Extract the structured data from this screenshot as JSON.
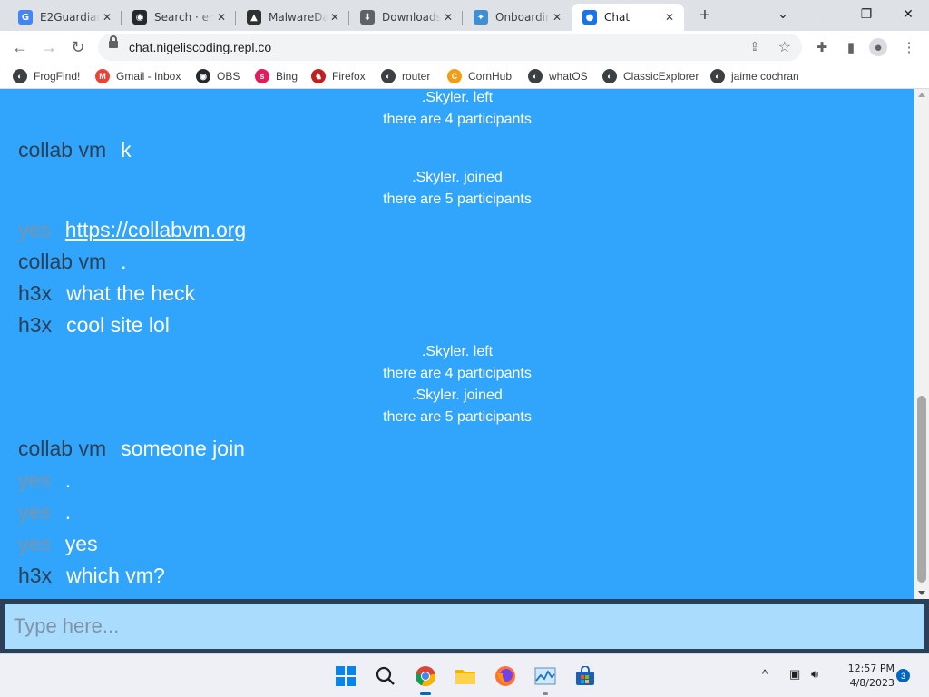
{
  "browser": {
    "tabs": [
      {
        "title": "E2Guardian",
        "icon": "google-icon",
        "color": "#4285f4",
        "glyph": "G"
      },
      {
        "title": "Search · en",
        "icon": "github-icon",
        "color": "#24292e",
        "glyph": "◉"
      },
      {
        "title": "MalwareDa",
        "icon": "malwaredata-icon",
        "color": "#303030",
        "glyph": "▲"
      },
      {
        "title": "Downloads",
        "icon": "download-icon",
        "color": "#5f6368",
        "glyph": "⬇"
      },
      {
        "title": "Onboardin",
        "icon": "replit-onboarding-icon",
        "color": "#3e8ed0",
        "glyph": "✦"
      },
      {
        "title": "Chat",
        "icon": "chat-icon",
        "color": "#1a73e8",
        "glyph": "●"
      }
    ],
    "url": "chat.nigeliscoding.repl.co",
    "bookmarks": [
      {
        "label": "FrogFind!",
        "icon": "globe-icon",
        "color": "#3c4043",
        "glyph": "◐"
      },
      {
        "label": "Gmail - Inbox",
        "icon": "gmail-icon",
        "color": "#ea4335",
        "glyph": "M"
      },
      {
        "label": "OBS",
        "icon": "github-icon",
        "color": "#24292e",
        "glyph": "◉"
      },
      {
        "label": "Bing",
        "icon": "sky-icon",
        "color": "#e21b5a",
        "glyph": "s"
      },
      {
        "label": "Firefox",
        "icon": "firefox-icon",
        "color": "#c41e1e",
        "glyph": "♞"
      },
      {
        "label": "router",
        "icon": "globe-icon",
        "color": "#3c4043",
        "glyph": "◐"
      },
      {
        "label": "CornHub",
        "icon": "cornhub-icon",
        "color": "#f29d12",
        "glyph": "C"
      },
      {
        "label": "whatOS",
        "icon": "globe-icon",
        "color": "#3c4043",
        "glyph": "◐"
      },
      {
        "label": "ClassicExplorer",
        "icon": "globe-icon",
        "color": "#3c4043",
        "glyph": "◐"
      },
      {
        "label": "jaime cochran",
        "icon": "globe-icon",
        "color": "#3c4043",
        "glyph": "◐"
      }
    ]
  },
  "chat": {
    "background": "#31a4fb",
    "system_blocks": [
      {
        "lines": [
          ".Skyler. left",
          "there are 4 participants"
        ]
      },
      {
        "lines": [
          ".Skyler. joined",
          "there are 5 participants"
        ]
      },
      {
        "lines": [
          ".Skyler. left",
          "there are 4 participants",
          ".Skyler. joined",
          "there are 5 participants"
        ]
      }
    ],
    "messages": [
      {
        "user": "collab vm",
        "text": "k",
        "user_style": "dark"
      },
      {
        "user": "yes",
        "text": "https://collabvm.org",
        "user_style": "gray",
        "is_link": true
      },
      {
        "user": "collab vm",
        "text": ".",
        "user_style": "dark"
      },
      {
        "user": "h3x",
        "text": "what the heck",
        "user_style": "dark"
      },
      {
        "user": "h3x",
        "text": "cool site lol",
        "user_style": "dark"
      },
      {
        "user": "collab vm",
        "text": "someone join",
        "user_style": "dark"
      },
      {
        "user": "yes",
        "text": ".",
        "user_style": "gray"
      },
      {
        "user": "yes",
        "text": ".",
        "user_style": "gray"
      },
      {
        "user": "yes",
        "text": "yes",
        "user_style": "gray"
      },
      {
        "user": "h3x",
        "text": "which vm?",
        "user_style": "dark"
      }
    ],
    "input_placeholder": "Type here..."
  },
  "taskbar": {
    "apps": [
      {
        "name": "start-button",
        "icon": "windows-icon",
        "state": ""
      },
      {
        "name": "search-button",
        "icon": "search-icon",
        "state": ""
      },
      {
        "name": "chrome-app",
        "icon": "chrome-icon",
        "state": "active"
      },
      {
        "name": "file-explorer-app",
        "icon": "folder-icon",
        "state": ""
      },
      {
        "name": "firefox-app",
        "icon": "firefox-icon",
        "state": ""
      },
      {
        "name": "task-manager-app",
        "icon": "task-manager-icon",
        "state": "run"
      },
      {
        "name": "store-app",
        "icon": "store-icon",
        "state": ""
      }
    ],
    "time": "12:57 PM",
    "date": "4/8/2023",
    "notifications": "3"
  }
}
